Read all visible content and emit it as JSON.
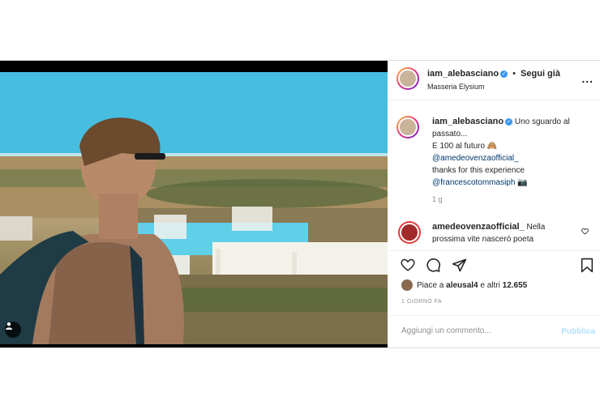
{
  "header": {
    "username": "iam_alebasciano",
    "follow_separator": "•",
    "follow_label": "Segui già",
    "location": "Masseria Elysium",
    "more_label": "..."
  },
  "caption": {
    "username": "iam_alebasciano",
    "line1": "Uno sguardo al passato...",
    "line2": "E 100 al futuro",
    "emoji2": "🙈",
    "mention1": "@amedeovenzaofficial_",
    "line3": "thanks for this experience",
    "mention2": "@francescotommasiph",
    "emoji3": "📷",
    "time": "1 g"
  },
  "comment": {
    "username": "amedeovenzaofficial_",
    "text": "Nella prossima vite nascerò poeta"
  },
  "likes": {
    "prefix": "Piace a",
    "user": "aleusal4",
    "suffix": "e altri",
    "count": "12.655"
  },
  "date": "1 GIORNO FA",
  "add_comment": {
    "placeholder": "Aggiungi un commento...",
    "publish_label": "Pubblica"
  },
  "colors": {
    "verified": "#3897f0",
    "mention": "#00376b",
    "publish_disabled": "#b2dffc",
    "muted": "#8e8e8e"
  }
}
